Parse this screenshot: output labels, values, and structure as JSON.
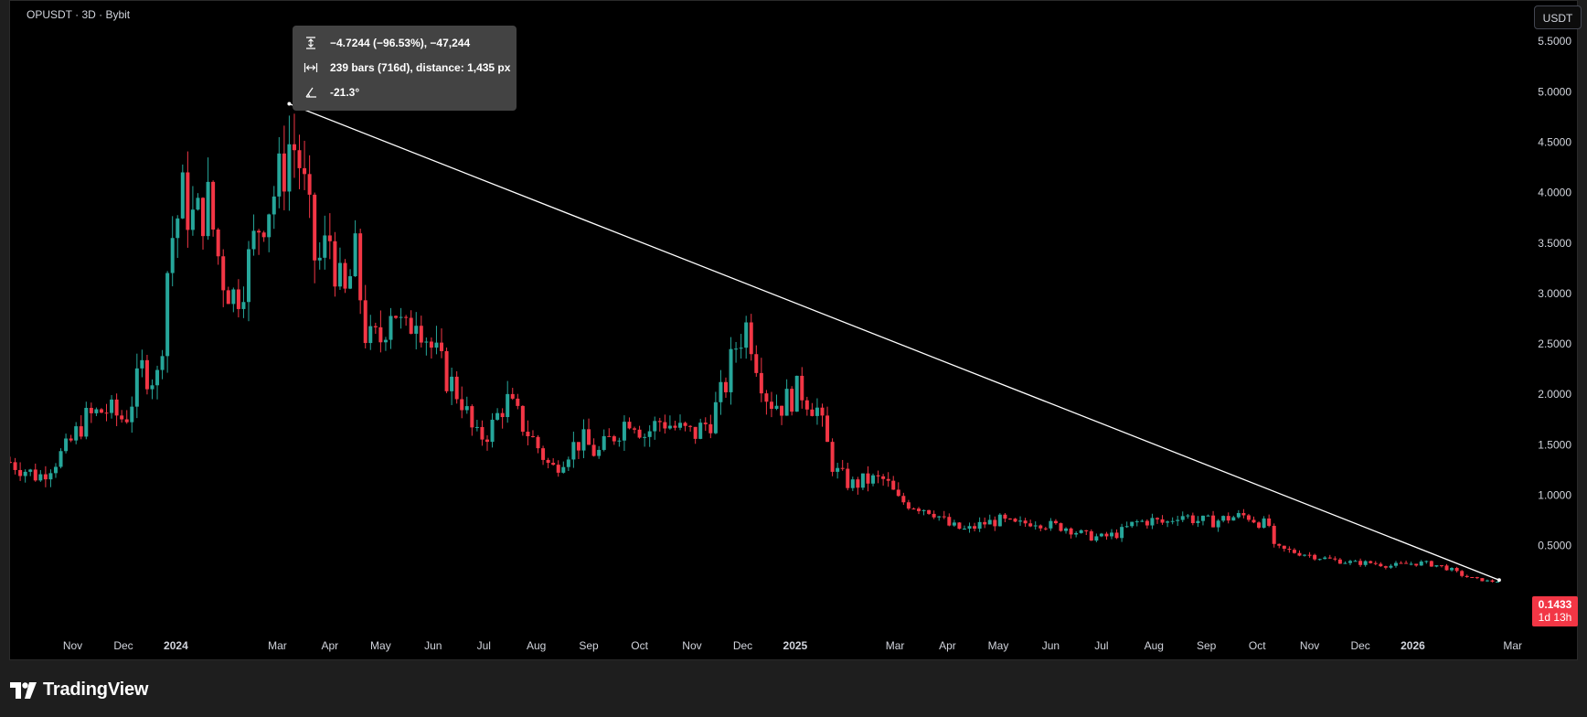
{
  "header": {
    "symbol_line": "OPUSDT · 3D · Bybit",
    "currency_button": "USDT"
  },
  "measure_tooltip": {
    "price_change": "−4.7244 (−96.53%), −47,244",
    "bars_distance": "239 bars (716d), distance: 1,435 px",
    "angle": "-21.3°"
  },
  "last_price": {
    "value": "0.1433",
    "countdown": "1d 13h",
    "color": "#f23645"
  },
  "branding": {
    "logo_text": "TradingView"
  },
  "icons": [
    "price-range-icon",
    "bars-range-icon",
    "angle-icon",
    "tradingview-logo-icon"
  ],
  "colors": {
    "up": "#26a69a",
    "down": "#f23645",
    "trendline": "#ffffff",
    "background": "#000000"
  },
  "chart_data": {
    "type": "candlestick",
    "symbol": "OPUSDT",
    "interval": "3D",
    "exchange": "Bybit",
    "y_axis": {
      "ticks": [
        "5.5000",
        "5.0000",
        "4.5000",
        "4.0000",
        "3.5000",
        "3.0000",
        "2.5000",
        "2.0000",
        "1.5000",
        "1.0000",
        "0.5000"
      ],
      "ylim": [
        -0.4,
        5.9
      ]
    },
    "x_axis": {
      "ticks": [
        {
          "label": "Nov",
          "date": "2023-11-01",
          "bold": false
        },
        {
          "label": "Dec",
          "date": "2023-12-01",
          "bold": false
        },
        {
          "label": "2024",
          "date": "2024-01-01",
          "bold": true
        },
        {
          "label": "Mar",
          "date": "2024-03-01",
          "bold": false
        },
        {
          "label": "Apr",
          "date": "2024-04-01",
          "bold": false
        },
        {
          "label": "May",
          "date": "2024-05-01",
          "bold": false
        },
        {
          "label": "Jun",
          "date": "2024-06-01",
          "bold": false
        },
        {
          "label": "Jul",
          "date": "2024-07-01",
          "bold": false
        },
        {
          "label": "Aug",
          "date": "2024-08-01",
          "bold": false
        },
        {
          "label": "Sep",
          "date": "2024-09-01",
          "bold": false
        },
        {
          "label": "Oct",
          "date": "2024-10-01",
          "bold": false
        },
        {
          "label": "Nov",
          "date": "2024-11-01",
          "bold": false
        },
        {
          "label": "Dec",
          "date": "2024-12-01",
          "bold": false
        },
        {
          "label": "2025",
          "date": "2025-01-01",
          "bold": true
        },
        {
          "label": "Mar",
          "date": "2025-03-01",
          "bold": false
        },
        {
          "label": "Apr",
          "date": "2025-04-01",
          "bold": false
        },
        {
          "label": "May",
          "date": "2025-05-01",
          "bold": false
        },
        {
          "label": "Jun",
          "date": "2025-06-01",
          "bold": false
        },
        {
          "label": "Jul",
          "date": "2025-07-01",
          "bold": false
        },
        {
          "label": "Aug",
          "date": "2025-08-01",
          "bold": false
        },
        {
          "label": "Sep",
          "date": "2025-09-01",
          "bold": false
        },
        {
          "label": "Oct",
          "date": "2025-10-01",
          "bold": false
        },
        {
          "label": "Nov",
          "date": "2025-11-01",
          "bold": false
        },
        {
          "label": "Dec",
          "date": "2025-12-01",
          "bold": false
        },
        {
          "label": "2026",
          "date": "2026-01-01",
          "bold": true
        },
        {
          "label": "Mar",
          "date": "2026-03-01",
          "bold": false
        }
      ],
      "xlim": [
        "2023-09-25",
        "2026-02-27"
      ]
    },
    "candle_interval_days": 3,
    "close_path": [
      [
        "2023-09-25",
        1.33
      ],
      [
        "2023-10-12",
        1.18
      ],
      [
        "2023-10-28",
        1.45
      ],
      [
        "2023-11-08",
        1.75
      ],
      [
        "2023-11-20",
        1.85
      ],
      [
        "2023-12-02",
        1.75
      ],
      [
        "2023-12-12",
        2.25
      ],
      [
        "2023-12-22",
        2.15
      ],
      [
        "2023-12-28",
        3.45
      ],
      [
        "2024-01-05",
        3.95
      ],
      [
        "2024-01-12",
        3.7
      ],
      [
        "2024-01-20",
        3.9
      ],
      [
        "2024-01-28",
        3.2
      ],
      [
        "2024-02-05",
        2.95
      ],
      [
        "2024-02-12",
        3.25
      ],
      [
        "2024-02-20",
        3.75
      ],
      [
        "2024-02-28",
        4.0
      ],
      [
        "2024-03-04",
        4.2
      ],
      [
        "2024-03-09",
        4.55
      ],
      [
        "2024-03-14",
        4.3
      ],
      [
        "2024-03-19",
        3.8
      ],
      [
        "2024-03-24",
        3.25
      ],
      [
        "2024-04-01",
        3.55
      ],
      [
        "2024-04-09",
        2.9
      ],
      [
        "2024-04-16",
        3.35
      ],
      [
        "2024-04-23",
        2.5
      ],
      [
        "2024-05-01",
        2.55
      ],
      [
        "2024-05-08",
        2.95
      ],
      [
        "2024-05-15",
        2.55
      ],
      [
        "2024-05-22",
        2.85
      ],
      [
        "2024-05-30",
        2.5
      ],
      [
        "2024-06-08",
        2.2
      ],
      [
        "2024-06-18",
        1.95
      ],
      [
        "2024-06-26",
        1.55
      ],
      [
        "2024-07-05",
        1.65
      ],
      [
        "2024-07-14",
        1.95
      ],
      [
        "2024-07-24",
        1.7
      ],
      [
        "2024-08-03",
        1.45
      ],
      [
        "2024-08-10",
        1.25
      ],
      [
        "2024-08-20",
        1.45
      ],
      [
        "2024-08-28",
        1.55
      ],
      [
        "2024-09-06",
        1.4
      ],
      [
        "2024-09-16",
        1.6
      ],
      [
        "2024-09-26",
        1.8
      ],
      [
        "2024-10-04",
        1.6
      ],
      [
        "2024-10-14",
        1.75
      ],
      [
        "2024-10-24",
        1.65
      ],
      [
        "2024-11-02",
        1.6
      ],
      [
        "2024-11-12",
        1.75
      ],
      [
        "2024-11-20",
        2.05
      ],
      [
        "2024-11-28",
        2.55
      ],
      [
        "2024-12-04",
        2.7
      ],
      [
        "2024-12-10",
        2.3
      ],
      [
        "2024-12-16",
        1.95
      ],
      [
        "2024-12-24",
        1.9
      ],
      [
        "2025-01-04",
        2.05
      ],
      [
        "2025-01-14",
        1.85
      ],
      [
        "2025-01-24",
        1.25
      ],
      [
        "2025-02-03",
        1.1
      ],
      [
        "2025-02-13",
        1.15
      ],
      [
        "2025-02-23",
        1.15
      ],
      [
        "2025-03-03",
        0.95
      ],
      [
        "2025-03-13",
        0.9
      ],
      [
        "2025-03-23",
        0.85
      ],
      [
        "2025-04-02",
        0.7
      ],
      [
        "2025-04-12",
        0.65
      ],
      [
        "2025-04-22",
        0.72
      ],
      [
        "2025-05-02",
        0.75
      ],
      [
        "2025-05-12",
        0.7
      ],
      [
        "2025-05-22",
        0.75
      ],
      [
        "2025-06-01",
        0.7
      ],
      [
        "2025-06-11",
        0.68
      ],
      [
        "2025-06-21",
        0.6
      ],
      [
        "2025-07-01",
        0.58
      ],
      [
        "2025-07-11",
        0.62
      ],
      [
        "2025-07-21",
        0.73
      ],
      [
        "2025-07-31",
        0.75
      ],
      [
        "2025-08-08",
        0.72
      ],
      [
        "2025-08-16",
        0.82
      ],
      [
        "2025-08-26",
        0.75
      ],
      [
        "2025-09-05",
        0.74
      ],
      [
        "2025-09-15",
        0.78
      ],
      [
        "2025-09-25",
        0.8
      ],
      [
        "2025-10-01",
        0.74
      ],
      [
        "2025-10-08",
        0.7
      ],
      [
        "2025-10-11",
        0.48
      ],
      [
        "2025-10-19",
        0.45
      ],
      [
        "2025-10-29",
        0.42
      ],
      [
        "2025-11-08",
        0.38
      ],
      [
        "2025-11-18",
        0.35
      ],
      [
        "2025-11-28",
        0.33
      ],
      [
        "2025-12-08",
        0.33
      ],
      [
        "2025-12-18",
        0.3
      ],
      [
        "2025-12-28",
        0.32
      ],
      [
        "2026-01-07",
        0.33
      ],
      [
        "2026-01-17",
        0.3
      ],
      [
        "2026-01-24",
        0.26
      ],
      [
        "2026-01-31",
        0.2
      ],
      [
        "2026-02-07",
        0.17
      ],
      [
        "2026-02-14",
        0.15
      ],
      [
        "2026-02-20",
        0.1433
      ]
    ],
    "trendline": {
      "start": [
        "2024-03-08",
        4.88
      ],
      "end": [
        "2026-02-21",
        0.16
      ]
    },
    "last_close": 0.1433
  }
}
